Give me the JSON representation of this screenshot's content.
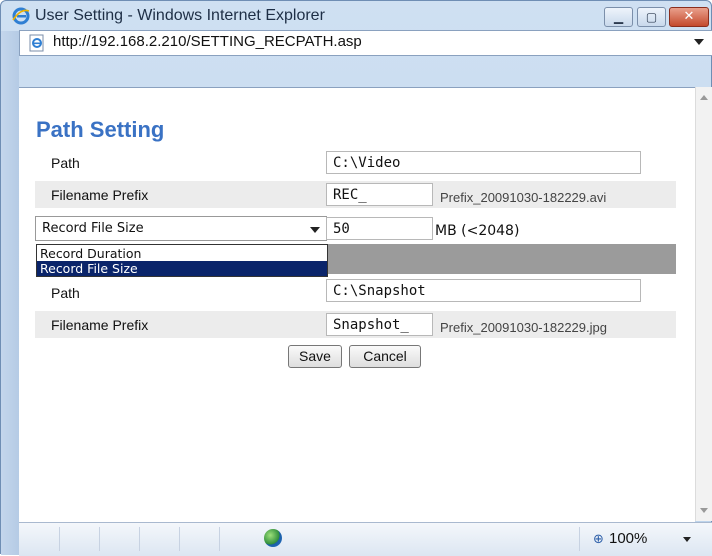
{
  "window": {
    "title": "User Setting - Windows Internet Explorer",
    "url": "http://192.168.2.210/SETTING_RECPATH.asp"
  },
  "page": {
    "title": "Path Setting",
    "record": {
      "path_label": "Path",
      "path_value": "C:\\Video",
      "prefix_label": "Filename Prefix",
      "prefix_value": "REC_",
      "prefix_example": "Prefix_20091030-182229.avi",
      "mode_selected": "Record File Size",
      "mode_options": [
        "Record Duration",
        "Record File Size"
      ],
      "size_value": "50",
      "size_unit_hint": "MB (<2048)"
    },
    "snapshot": {
      "path_label": "Path",
      "path_value": "C:\\Snapshot",
      "prefix_label": "Filename Prefix",
      "prefix_value": "Snapshot_",
      "prefix_example": "Prefix_20091030-182229.jpg"
    },
    "buttons": {
      "save": "Save",
      "cancel": "Cancel"
    }
  },
  "statusbar": {
    "zoom": "100%"
  },
  "icons": {
    "title": "ie-logo-icon",
    "address": "page-icon",
    "zone": "globe-icon",
    "zoom": "magnifier-icon"
  }
}
